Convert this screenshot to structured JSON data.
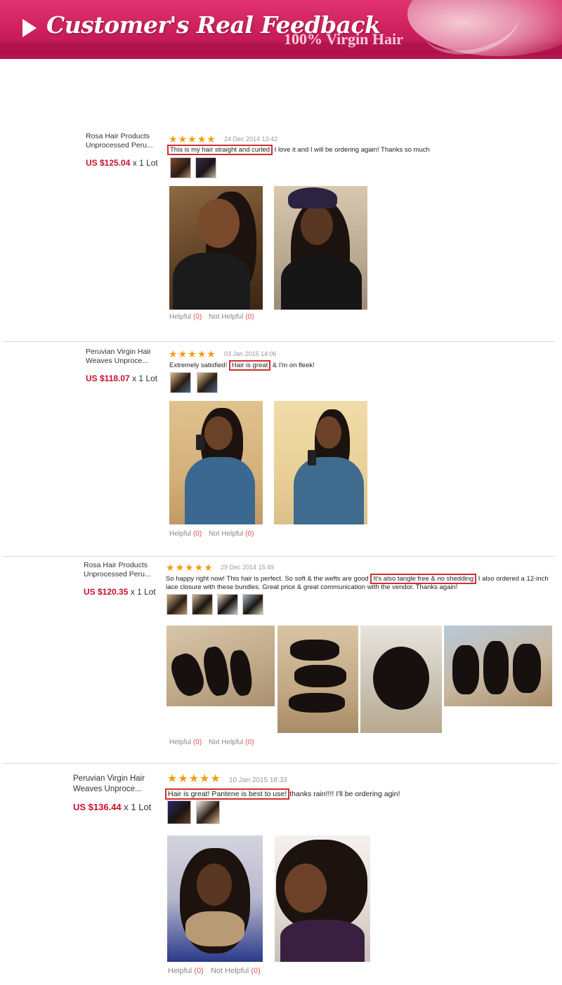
{
  "banner": {
    "title": "Customer's Real Feedback",
    "subtitle": "100% Virgin Hair"
  },
  "reviews": [
    {
      "product_line1": "Rosa Hair Products",
      "product_line2": "Unprocessed Peru...",
      "price": "US $125.04",
      "quantity": "x 1 Lot",
      "stars": 5,
      "date": "24 Dec 2014 13:42",
      "text_before": "",
      "highlight": "This is my hair straight and curled",
      "text_after": " I love it and I will be ordering again! Thanks so much",
      "helpful_label": "Helpful",
      "helpful_count": "(0)",
      "not_helpful_label": "Not Helpful",
      "not_helpful_count": "(0)"
    },
    {
      "product_line1": "Peruvian Virgin Hair",
      "product_line2": "Weaves Unproce...",
      "price": "US $118.07",
      "quantity": "x 1 Lot",
      "stars": 5,
      "date": "03 Jan 2015 14:06",
      "text_before": "Extremely satisfied! ",
      "highlight": "Hair is great",
      "text_after": " & I'm on fleek!",
      "helpful_label": "Helpful",
      "helpful_count": "(0)",
      "not_helpful_label": "Not Helpful",
      "not_helpful_count": "(0)"
    },
    {
      "product_line1": "Rosa Hair Products",
      "product_line2": "Unprocessed Peru...",
      "price": "US $120.35",
      "quantity": "x 1 Lot",
      "stars": 5,
      "date": "29 Dec 2014 15:49",
      "text_before": "So happy right now! This hair is perfect. So soft & the wefts are good ",
      "highlight": "It's also tangle free & no shedding",
      "text_after": " I also ordered a 12-inch lace closure with these bundles. Great price & great communication with the vendor. Thanks again!",
      "helpful_label": "Helpful",
      "helpful_count": "(0)",
      "not_helpful_label": "Not Helpful",
      "not_helpful_count": "(0)"
    },
    {
      "product_line1": "Peruvian Virgin Hair",
      "product_line2": "Weaves Unproce...",
      "price": "US $136.44",
      "quantity": "x 1 Lot",
      "stars": 5,
      "date": "10 Jan 2015 18:33",
      "text_before": "",
      "highlight": "Hair is great! Pantene is best to use!",
      "text_after": "thanks rain!!!! I'll be ordering agin!",
      "helpful_label": "Helpful",
      "helpful_count": "(0)",
      "not_helpful_label": "Not Helpful",
      "not_helpful_count": "(0)"
    }
  ],
  "colors": {
    "banner": "#c41a55",
    "price": "#c8102e",
    "star": "#f39c12",
    "highlight_border": "#d32f2f"
  },
  "icons": {
    "banner": "play-triangle-icon",
    "rating": "star-icon"
  }
}
